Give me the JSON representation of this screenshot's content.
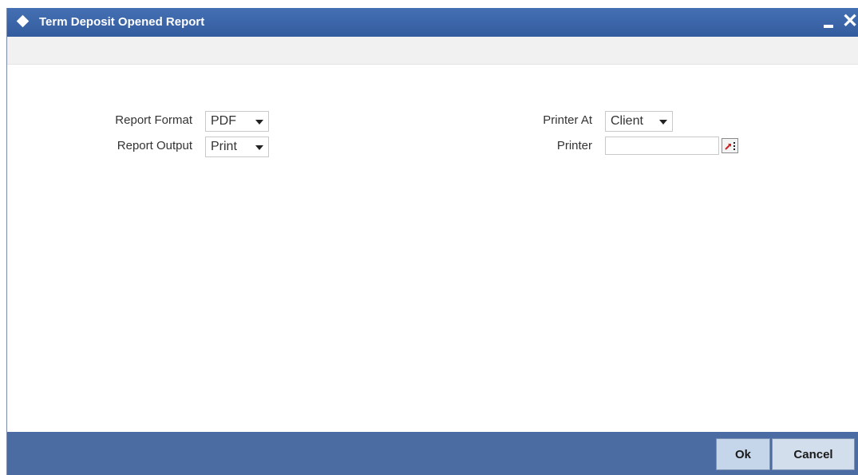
{
  "window": {
    "title": "Term Deposit Opened Report"
  },
  "form": {
    "report_format": {
      "label": "Report Format",
      "value": "PDF"
    },
    "report_output": {
      "label": "Report Output",
      "value": "Print"
    },
    "printer_at": {
      "label": "Printer At",
      "value": "Client"
    },
    "printer": {
      "label": "Printer",
      "value": ""
    }
  },
  "footer": {
    "ok_label": "Ok",
    "cancel_label": "Cancel"
  },
  "colors": {
    "titlebar": "#3c66a8",
    "footer": "#4a6ca3",
    "button": "#c5d5ea"
  },
  "icons": {
    "title": "diamond-icon",
    "minimize": "minimize-icon",
    "close": "close-icon",
    "lov": "lov-search-icon"
  }
}
